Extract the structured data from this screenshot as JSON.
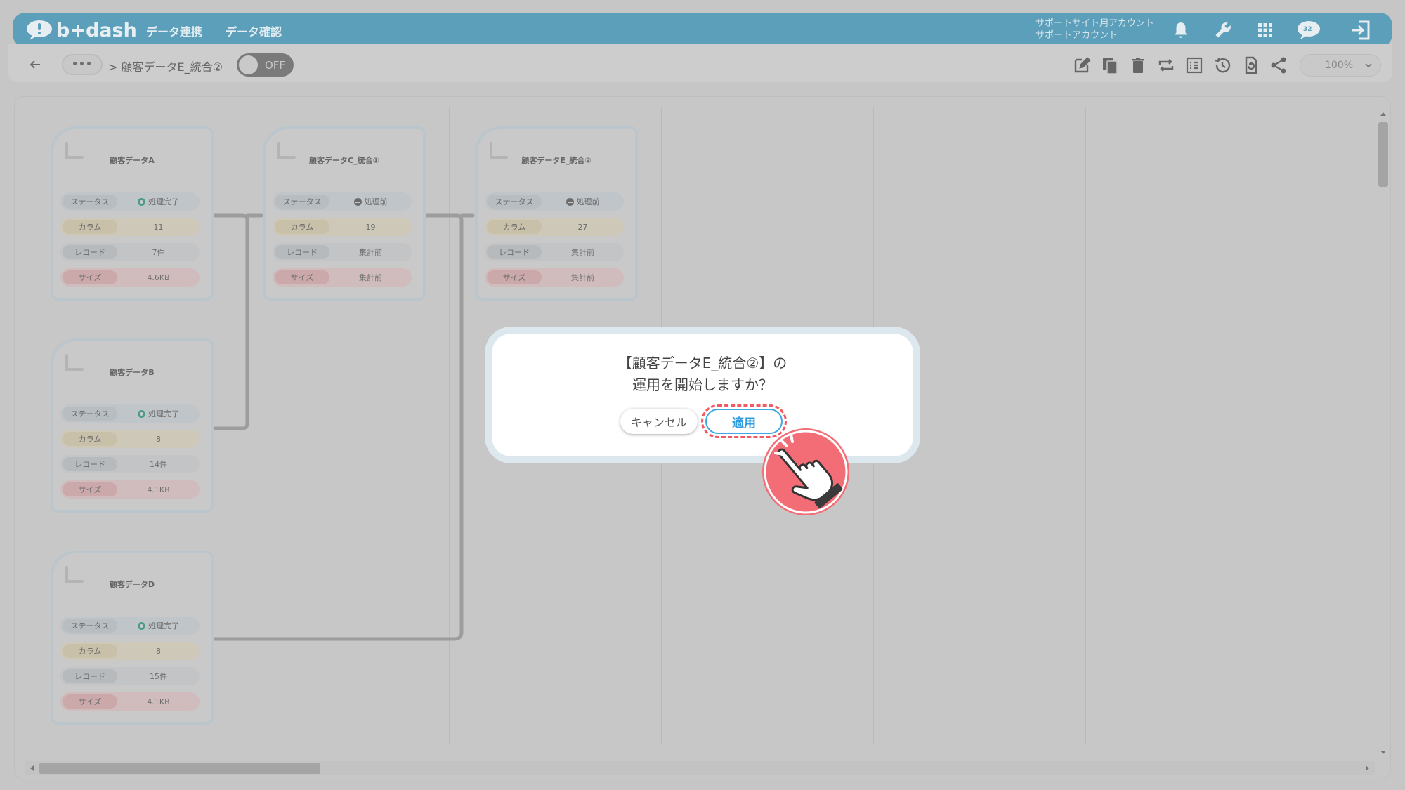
{
  "header": {
    "logo_text": "b+dash",
    "nav": [
      "データ連携",
      "データ確認"
    ],
    "account_line1": "サポートサイト用アカウント",
    "account_line2": "サポートアカウント",
    "badge": "32",
    "icons": [
      "bell-icon",
      "wrench-icon",
      "apps-grid-icon",
      "chat-icon",
      "logout-icon"
    ]
  },
  "toolbar": {
    "dots": "•••",
    "breadcrumb": "> 顧客データE_統合②",
    "toggle_label": "OFF",
    "zoom": "100%",
    "icons": [
      "edit-icon",
      "copy-icon",
      "trash-icon",
      "repeat-icon",
      "list-icon",
      "history-icon",
      "refresh-icon",
      "share-icon"
    ]
  },
  "cards": [
    {
      "title": "顧客データA",
      "status_key": "ステータス",
      "status": "処理完了",
      "col_key": "カラム",
      "col": "11",
      "rec_key": "レコード",
      "rec": "7件",
      "size_key": "サイズ",
      "size": "4.6KB"
    },
    {
      "title": "顧客データC_統合①",
      "status_key": "ステータス",
      "status": "処理前",
      "col_key": "カラム",
      "col": "19",
      "rec_key": "レコード",
      "rec": "集計前",
      "size_key": "サイズ",
      "size": "集計前"
    },
    {
      "title": "顧客データE_統合②",
      "status_key": "ステータス",
      "status": "処理前",
      "col_key": "カラム",
      "col": "27",
      "rec_key": "レコード",
      "rec": "集計前",
      "size_key": "サイズ",
      "size": "集計前"
    },
    {
      "title": "顧客データB",
      "status_key": "ステータス",
      "status": "処理完了",
      "col_key": "カラム",
      "col": "8",
      "rec_key": "レコード",
      "rec": "14件",
      "size_key": "サイズ",
      "size": "4.1KB"
    },
    {
      "title": "顧客データD",
      "status_key": "ステータス",
      "status": "処理完了",
      "col_key": "カラム",
      "col": "8",
      "rec_key": "レコード",
      "rec": "15件",
      "size_key": "サイズ",
      "size": "4.1KB"
    }
  ],
  "dialog": {
    "line1": "【顧客データE_統合②】の",
    "line2": "運用を開始しますか？",
    "cancel": "キャンセル",
    "apply": "適用"
  },
  "colors": {
    "header_bg": "#5b9fbb",
    "apply_blue": "#3fa8e3",
    "highlight_red": "#f15a63",
    "done_green": "#4d9a85"
  }
}
